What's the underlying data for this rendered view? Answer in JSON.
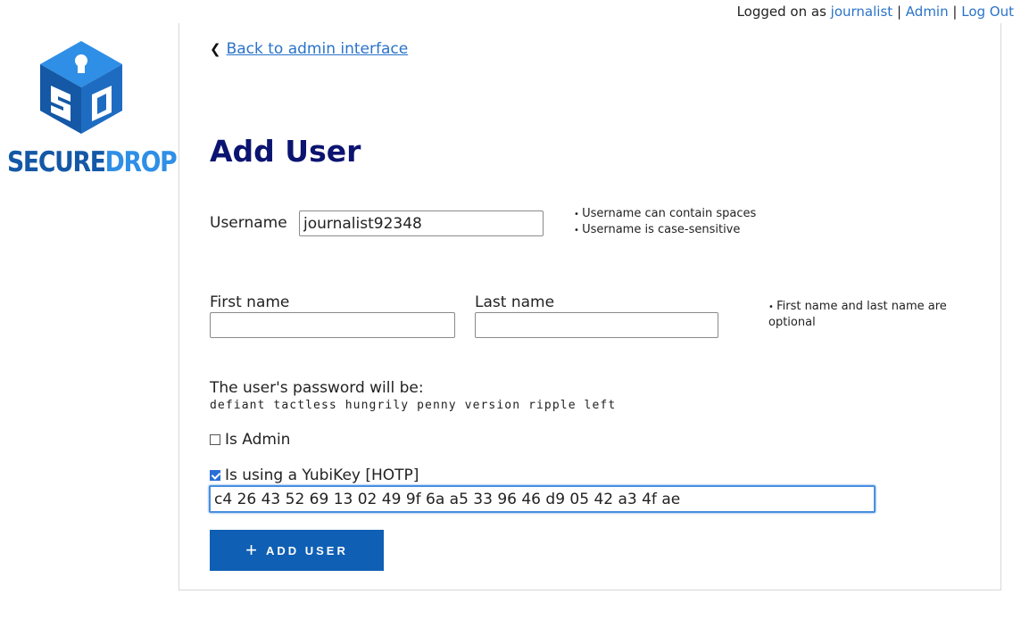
{
  "topbar": {
    "prefix": "Logged on as",
    "user": "journalist",
    "sep": "|",
    "admin": "Admin",
    "logout": "Log Out"
  },
  "logo": {
    "word_a": "SECURE",
    "word_b": "DROP"
  },
  "back_link": "Back to admin interface",
  "title": "Add User",
  "username": {
    "label": "Username",
    "value": "journalist92348",
    "hints": [
      "Username can contain spaces",
      "Username is case-sensitive"
    ]
  },
  "first_name": {
    "label": "First name",
    "value": ""
  },
  "last_name": {
    "label": "Last name",
    "value": ""
  },
  "name_hint": "First name and last name are optional",
  "password": {
    "label": "The user's password will be:",
    "value": "defiant tactless hungrily penny version ripple left"
  },
  "is_admin": {
    "label": "Is Admin",
    "checked": false
  },
  "yubikey": {
    "label": "Is using a YubiKey [HOTP]",
    "checked": true,
    "value": "c4 26 43 52 69 13 02 49 9f 6a a5 33 96 46 d9 05 42 a3 4f ae"
  },
  "submit": {
    "icon": "plus-icon",
    "label": "ADD USER"
  },
  "colors": {
    "link": "#2a73c9",
    "title": "#0b1470",
    "button": "#0f5fb4",
    "logo_dark": "#1458a6",
    "logo_light": "#2f8fe6"
  }
}
